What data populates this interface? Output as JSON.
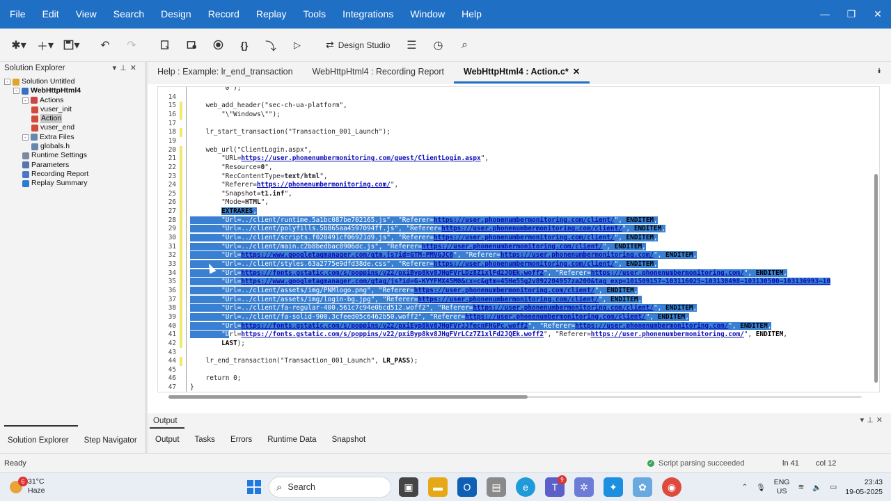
{
  "menu": [
    "File",
    "Edit",
    "View",
    "Search",
    "Design",
    "Record",
    "Replay",
    "Tools",
    "Integrations",
    "Window",
    "Help"
  ],
  "window_controls": {
    "minimize": "—",
    "restore": "❐",
    "close": "✕"
  },
  "toolbar": {
    "design_studio_label": "Design Studio"
  },
  "solution_explorer": {
    "title": "Solution Explorer",
    "items": [
      {
        "label": "Solution Untitled",
        "level": 0,
        "toggle": "-",
        "icon": "solution-icon"
      },
      {
        "label": "WebHttpHtml4",
        "level": 1,
        "toggle": "-",
        "icon": "script-icon",
        "bold": true
      },
      {
        "label": "Actions",
        "level": 2,
        "toggle": "-",
        "icon": "actions-icon"
      },
      {
        "label": "vuser_init",
        "level": 3,
        "icon": "action-file-icon"
      },
      {
        "label": "Action",
        "level": 3,
        "icon": "action-file-icon",
        "selected": true
      },
      {
        "label": "vuser_end",
        "level": 3,
        "icon": "action-file-icon"
      },
      {
        "label": "Extra Files",
        "level": 2,
        "toggle": "-",
        "icon": "folder-icon"
      },
      {
        "label": "globals.h",
        "level": 3,
        "icon": "header-file-icon"
      },
      {
        "label": "Runtime Settings",
        "level": 2,
        "icon": "settings-icon"
      },
      {
        "label": "Parameters",
        "level": 2,
        "icon": "parameters-icon"
      },
      {
        "label": "Recording Report",
        "level": 2,
        "icon": "report-icon"
      },
      {
        "label": "Replay Summary",
        "level": 2,
        "icon": "summary-icon"
      }
    ],
    "bottom_tabs": [
      "Solution Explorer",
      "Step Navigator"
    ]
  },
  "editor_tabs": [
    {
      "label": "Help : Example: lr_end_transaction",
      "active": false
    },
    {
      "label": "WebHttpHtml4 : Recording Report",
      "active": false
    },
    {
      "label": "WebHttpHtml4 : Action.c*",
      "active": true,
      "close": "✕"
    }
  ],
  "code_lines": [
    {
      "n": "",
      "t": "        \"0\");"
    },
    {
      "n": "14",
      "t": ""
    },
    {
      "n": "15",
      "t": "    web_add_header(\"sec-ch-ua-platform\","
    },
    {
      "n": "16",
      "t": "        \"\\\"Windows\\\"\");"
    },
    {
      "n": "17",
      "t": ""
    },
    {
      "n": "18",
      "t": "    lr_start_transaction(\"Transaction_001_Launch\");"
    },
    {
      "n": "19",
      "t": ""
    },
    {
      "n": "20",
      "t": "    web_url(\"ClientLogin.aspx\","
    },
    {
      "n": "21",
      "t": "        \"URL=https://user.phonenumbermonitoring.com/guest/ClientLogin.aspx\","
    },
    {
      "n": "22",
      "t": "        \"Resource=0\","
    },
    {
      "n": "23",
      "t": "        \"RecContentType=text/html\","
    },
    {
      "n": "24",
      "t": "        \"Referer=https://phonenumbermonitoring.com/\","
    },
    {
      "n": "25",
      "t": "        \"Snapshot=t1.inf\","
    },
    {
      "n": "26",
      "t": "        \"Mode=HTML\","
    },
    {
      "n": "27",
      "t": "        EXTRARES,"
    },
    {
      "n": "28",
      "t": "        \"Url=../client/runtime.5a1bc087be702165.js\", \"Referer=https://user.phonenumbermonitoring.com/client/\", ENDITEM,"
    },
    {
      "n": "29",
      "t": "        \"Url=../client/polyfills.5b865aa4597094ff.js\", \"Referer=https://user.phonenumbermonitoring.com/client/\", ENDITEM,"
    },
    {
      "n": "30",
      "t": "        \"Url=../client/scripts.f020491cf06921d9.js\", \"Referer=https://user.phonenumbermonitoring.com/client/\", ENDITEM,"
    },
    {
      "n": "31",
      "t": "        \"Url=../client/main.c2b8bedbac8906dc.js\", \"Referer=https://user.phonenumbermonitoring.com/client/\", ENDITEM,"
    },
    {
      "n": "32",
      "t": "        \"Url=https://www.googletagmanager.com/gtm.js?id=GTM-PMVGJC6\", \"Referer=https://user.phonenumbermonitoring.com/\", ENDITEM,"
    },
    {
      "n": "33",
      "t": "        \"Url=../client/styles.63a2775e9dfd38de.css\", \"Referer=https://user.phonenumbermonitoring.com/client/\", ENDITEM,"
    },
    {
      "n": "34",
      "t": "        \"Url=https://fonts.gstatic.com/s/poppins/v22/pxiByp8kv8JHgFVrLDz8Z1xlFd2JQEk.woff2\", \"Referer=https://user.phonenumbermonitoring.com/\", ENDITEM,"
    },
    {
      "n": "35",
      "t": "        \"Url=https://www.googletagmanager.com/gtag/js?id=G-KYYFMX45M0&cx=c&gtm=45He55g2v892204957za200&tag_exp=101509157~103116025~103130498~103130500~103136993~10"
    },
    {
      "n": "36",
      "t": "        \"Url=../client/assets/img/PNMlogo.png\", \"Referer=https://user.phonenumbermonitoring.com/client/\", ENDITEM,"
    },
    {
      "n": "37",
      "t": "        \"Url=../client/assets/img/login-bg.jpg\", \"Referer=https://user.phonenumbermonitoring.com/client/\", ENDITEM,"
    },
    {
      "n": "38",
      "t": "        \"Url=../client/fa-regular-400.561c7c94e0bcd512.woff2\", \"Referer=https://user.phonenumbermonitoring.com/client/\", ENDITEM,"
    },
    {
      "n": "39",
      "t": "        \"Url=../client/fa-solid-900.3cfeed05c6462b50.woff2\", \"Referer=https://user.phonenumbermonitoring.com/client/\", ENDITEM,"
    },
    {
      "n": "40",
      "t": "        \"Url=https://fonts.gstatic.com/s/poppins/v22/pxiEyp8kv8JHgFVrJJfecnFHGPc.woff2\", \"Referer=https://user.phonenumbermonitoring.com/\", ENDITEM,"
    },
    {
      "n": "41",
      "t": "        \"Url=https://fonts.gstatic.com/s/poppins/v22/pxiByp8kv8JHgFVrLCz7Z1xlFd2JQEk.woff2\", \"Referer=https://user.phonenumbermonitoring.com/\", ENDITEM,"
    },
    {
      "n": "42",
      "t": "        LAST);"
    },
    {
      "n": "43",
      "t": ""
    },
    {
      "n": "44",
      "t": "    lr_end_transaction(\"Transaction_001_Launch\", LR_PASS);"
    },
    {
      "n": "45",
      "t": ""
    },
    {
      "n": "46",
      "t": "    return 0;"
    },
    {
      "n": "47",
      "t": "}"
    }
  ],
  "output": {
    "title": "Output",
    "tabs": [
      "Output",
      "Tasks",
      "Errors",
      "Runtime Data",
      "Snapshot"
    ]
  },
  "status": {
    "ready": "Ready",
    "message": "Script parsing succeeded",
    "ln": "ln 41",
    "col": "col 12",
    "success_color": "#3aa357"
  },
  "taskbar": {
    "weather_temp": "31°C",
    "weather_desc": "Haze",
    "weather_badge": "6",
    "search_label": "Search",
    "teams_badge": "9",
    "lang_top": "ENG",
    "lang_bottom": "US",
    "time": "23:43",
    "date": "19-05-2025"
  },
  "colors": {
    "menubar": "#1f6fc5",
    "selection": "#3a80d2",
    "accent_tab": "#1f6fc5"
  }
}
